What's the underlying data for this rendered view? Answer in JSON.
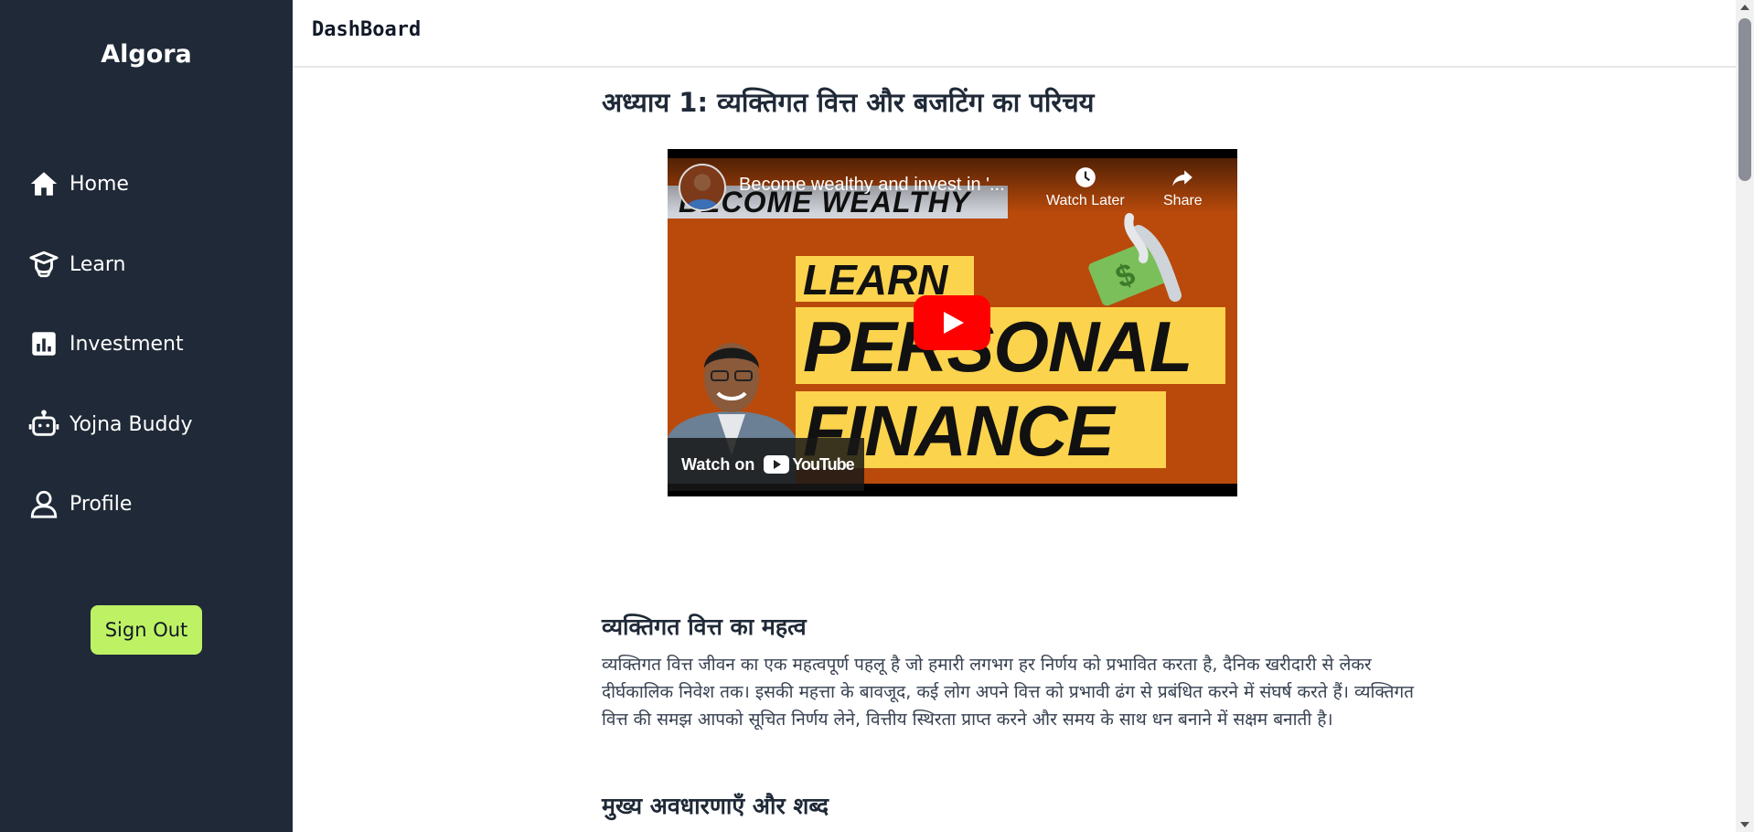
{
  "sidebar": {
    "brand": "Algora",
    "items": [
      {
        "label": "Home",
        "icon": "home-icon"
      },
      {
        "label": "Learn",
        "icon": "graduation-cap-icon"
      },
      {
        "label": "Investment",
        "icon": "bar-chart-icon"
      },
      {
        "label": "Yojna Buddy",
        "icon": "robot-icon"
      },
      {
        "label": "Profile",
        "icon": "user-icon"
      }
    ],
    "signout_label": "Sign Out"
  },
  "header": {
    "title": "DashBoard"
  },
  "main": {
    "chapter_title": "अध्याय 1: व्यक्तिगत वित्त और बजटिंग का परिचय",
    "video": {
      "title": "Become wealthy and invest in '...",
      "watch_later": "Watch Later",
      "share": "Share",
      "watch_on": "Watch on",
      "youtube": "YouTube",
      "thumb_banner": "BECOME WEALTHY",
      "thumb_learn": "LEARN",
      "thumb_personal": "PERSONAL",
      "thumb_finance": "FINANCE"
    },
    "section1_heading": "व्यक्तिगत वित्त का महत्व",
    "section1_text": "व्यक्तिगत वित्त जीवन का एक महत्वपूर्ण पहलू है जो हमारी लगभग हर निर्णय को प्रभावित करता है, दैनिक खरीदारी से लेकर दीर्घकालिक निवेश तक। इसकी महत्ता के बावजूद, कई लोग अपने वित्त को प्रभावी ढंग से प्रबंधित करने में संघर्ष करते हैं। व्यक्तिगत वित्त की समझ आपको सूचित निर्णय लेने, वित्तीय स्थिरता प्राप्त करने और समय के साथ धन बनाने में सक्षम बनाती है।",
    "section2_heading": "मुख्य अवधारणाएँ और शब्द"
  },
  "colors": {
    "sidebar_bg": "#1f2937",
    "signout_bg": "#bef264",
    "thumb_bg": "#b94a0b",
    "highlight_yellow": "#fcd34d",
    "youtube_red": "#ff0000"
  }
}
